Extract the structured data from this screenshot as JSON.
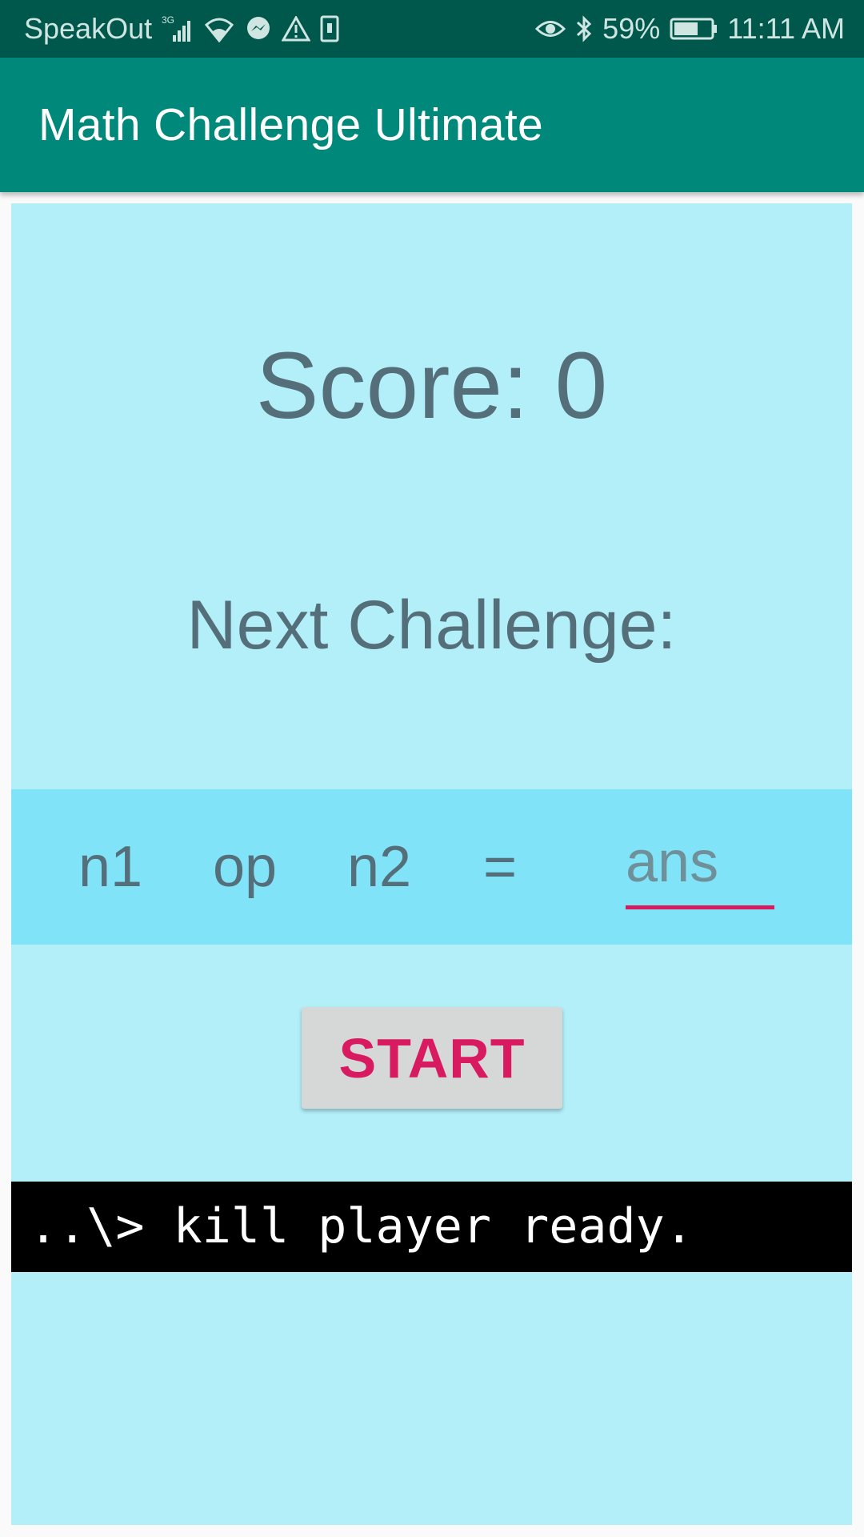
{
  "status_bar": {
    "carrier": "SpeakOut",
    "network_type": "3G",
    "battery": "59%",
    "time": "11:11 AM",
    "icons": [
      "signal-icon",
      "wifi-icon",
      "messenger-icon",
      "warning-icon",
      "sim-icon",
      "eye-icon",
      "bluetooth-icon",
      "battery-icon"
    ]
  },
  "app_bar": {
    "title": "Math Challenge Ultimate"
  },
  "main": {
    "score_text": "Score: 0",
    "next_challenge_text": "Next Challenge:",
    "equation": {
      "n1": "n1",
      "op": "op",
      "n2": "n2",
      "equals": "=",
      "answer_value": "",
      "answer_placeholder": "ans"
    },
    "start_label": "START",
    "console_text": "..\\> kill player ready."
  },
  "colors": {
    "status_bar": "#00574b",
    "app_bar": "#00897b",
    "content_bg": "#b2eff9",
    "equation_bg": "#80e3f8",
    "accent": "#d81b60",
    "text": "#546e7a",
    "button_bg": "#d6d8d8"
  }
}
